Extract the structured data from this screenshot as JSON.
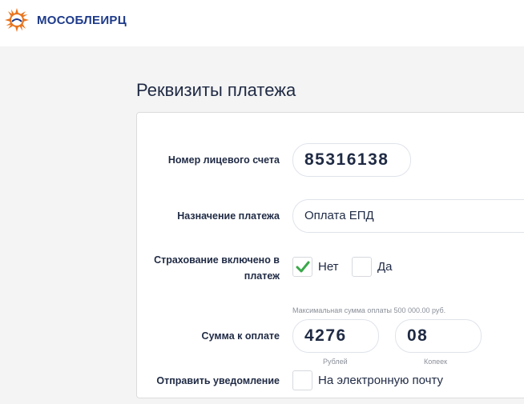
{
  "header": {
    "logo_text_a": "МОСОБЛ",
    "logo_text_b": "ЕИРЦ",
    "logo_icon": "sun-logo-icon",
    "brand_colors": {
      "blue": "#1d3a8a",
      "orange": "#e8731b"
    }
  },
  "page": {
    "title": "Реквизиты платежа"
  },
  "form": {
    "account_label": "Номер лицевого счета",
    "account_value": "85316138",
    "purpose_label": "Назначение платежа",
    "purpose_value": "Оплата ЕПД",
    "insurance_label": "Страхование включено в платеж",
    "insurance_options": [
      {
        "label": "Нет",
        "checked": true
      },
      {
        "label": "Да",
        "checked": false
      }
    ],
    "amount_hint": "Максимальная сумма оплаты 500 000.00 руб.",
    "amount_label": "Сумма к оплате",
    "rubles_value": "4276",
    "rubles_caption": "Рублей",
    "kopecks_value": "08",
    "kopecks_caption": "Копеек",
    "notify_label": "Отправить уведомление",
    "notify_option": "На электронную почту",
    "notify_checked": false,
    "accent_color": "#3aa84a"
  }
}
